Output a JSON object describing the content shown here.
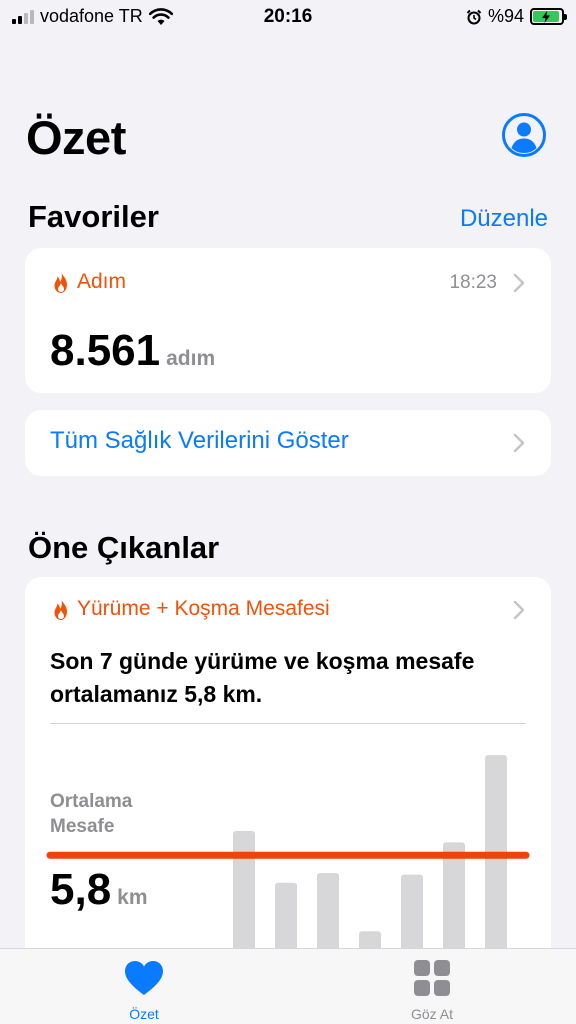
{
  "status_bar": {
    "carrier": "vodafone TR",
    "time": "20:16",
    "battery": "%94",
    "battery_level": 0.94,
    "signal_bars": 2
  },
  "header": {
    "title": "Özet",
    "profile_icon": "person-circle-icon"
  },
  "favorites": {
    "title": "Favoriler",
    "edit_label": "Düzenle",
    "steps_card": {
      "icon": "flame-icon",
      "label": "Adım",
      "time": "18:23",
      "value": "8.561",
      "unit": "adım"
    },
    "show_all_label": "Tüm Sağlık Verilerini Göster"
  },
  "highlights": {
    "title": "Öne Çıkanlar",
    "card": {
      "icon": "flame-icon",
      "label": "Yürüme + Koşma Mesafesi",
      "text": "Son 7 günde yürüme ve koşma mesafe ortalamanız 5,8 km.",
      "avg_label": "Ortalama Mesafe",
      "avg_value": "5,8",
      "avg_unit": "km"
    }
  },
  "chart_data": {
    "type": "bar",
    "title": "",
    "xlabel": "",
    "ylabel": "",
    "unit": "km",
    "average": 5.8,
    "values": [
      7.3,
      4.1,
      4.7,
      1.1,
      4.6,
      6.6,
      12.0
    ],
    "ylim": [
      0,
      12.5
    ],
    "grid": false,
    "colors": {
      "bars": "#d7d7d9",
      "average_line": "#f0420a"
    }
  },
  "tab_bar": {
    "tabs": [
      {
        "label": "Özet",
        "icon": "heart-icon",
        "active": true
      },
      {
        "label": "Göz At",
        "icon": "grid-icon",
        "active": false
      }
    ]
  },
  "colors": {
    "accent": "#0a7aff",
    "orange": "#f0520a",
    "background": "#f2f2f7",
    "secondary_text": "#8e8e93"
  }
}
